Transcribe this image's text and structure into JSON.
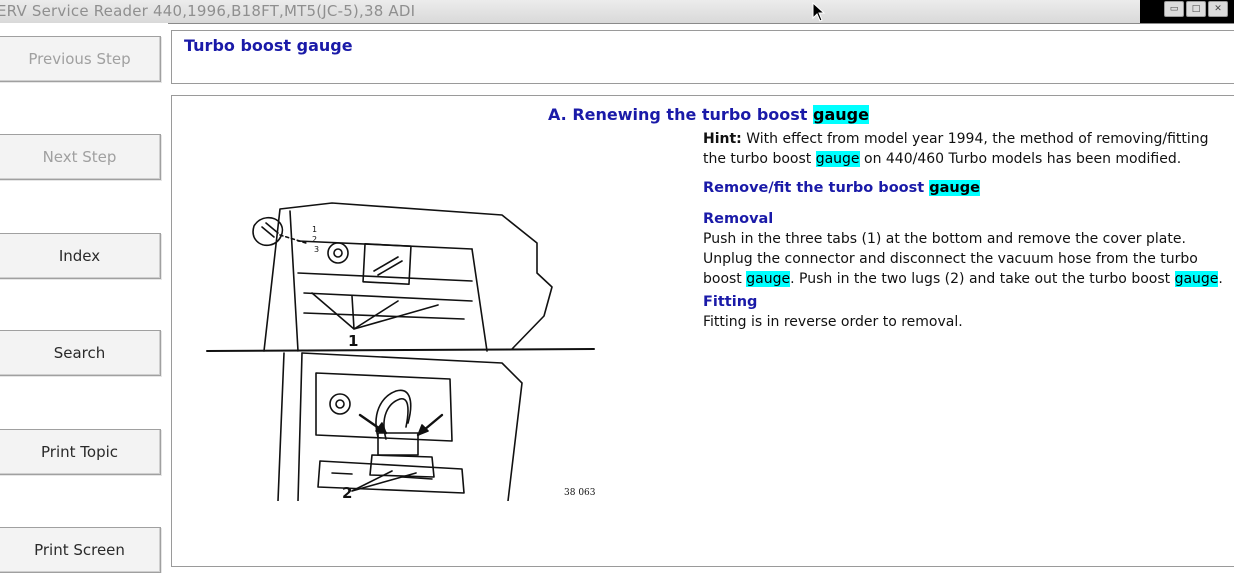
{
  "window": {
    "title": "ERV Service Reader 440,1996,B18FT,MT5(JC-5),38 ADI",
    "min_glyph": "▭",
    "max_glyph": "□",
    "close_glyph": "✕"
  },
  "sidebar": {
    "previous_step": "Previous Step",
    "next_step": "Next Step",
    "index": "Index",
    "search": "Search",
    "print_topic": "Print Topic",
    "print_screen": "Print Screen"
  },
  "header": {
    "topic_title": "Turbo boost gauge"
  },
  "article": {
    "section_title_pre": "A. Renewing the turbo boost ",
    "highlight_term": "gauge",
    "hint_label": "Hint:",
    "hint_pre": " With effect from model year 1994, the method of removing/fitting the turbo boost ",
    "hint_post": " on 440/460 Turbo models has been modified.",
    "subtitle_pre": "Remove/fit the turbo boost ",
    "removal_heading": "Removal",
    "removal_pre": "Push in the three tabs (1) at the bottom and remove the cover plate. Unplug the connector and disconnect the vacuum hose from the turbo boost ",
    "removal_mid": ". Push in the two lugs (2) and take out the turbo boost ",
    "removal_post": ".",
    "fitting_heading": "Fitting",
    "fitting_text": "Fitting is in reverse order to removal."
  },
  "illustration": {
    "callout_1": "1",
    "callout_2": "2",
    "small_1": "1",
    "small_2": "2",
    "small_3": "3",
    "ref_number": "38 063"
  },
  "colors": {
    "heading_blue": "#1a1aa8",
    "highlight": "#00ffff",
    "disabled_text": "#a0a0a0"
  }
}
